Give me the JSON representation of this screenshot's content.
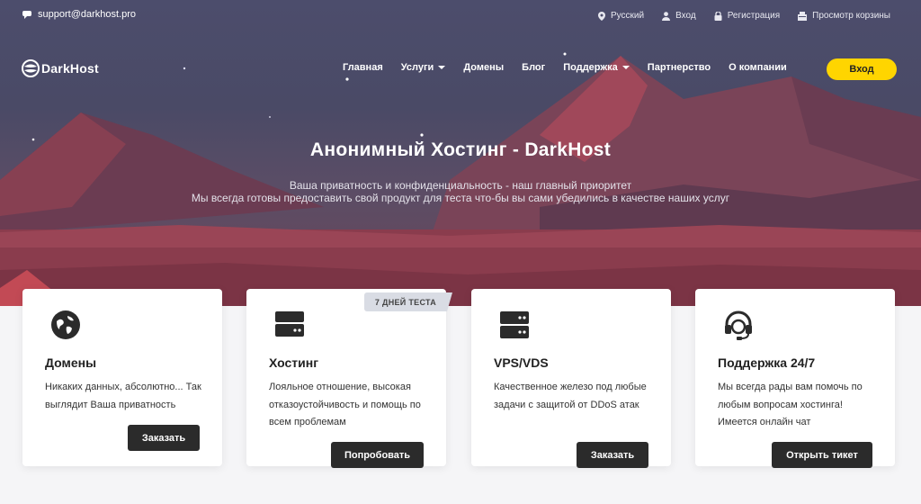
{
  "topbar": {
    "email": "support@darkhost.pro",
    "links": [
      {
        "label": "Русский",
        "icon": "location-pin-icon"
      },
      {
        "label": "Вход",
        "icon": "user-icon"
      },
      {
        "label": "Регистрация",
        "icon": "lock-icon"
      },
      {
        "label": "Просмотр корзины",
        "icon": "cart-icon"
      }
    ]
  },
  "nav": {
    "logo": "DarkHost",
    "items": [
      {
        "label": "Главная",
        "dropdown": false
      },
      {
        "label": "Услуги",
        "dropdown": true
      },
      {
        "label": "Домены",
        "dropdown": false
      },
      {
        "label": "Блог",
        "dropdown": false
      },
      {
        "label": "Поддержка",
        "dropdown": true
      },
      {
        "label": "Партнерство",
        "dropdown": false
      },
      {
        "label": "О компании",
        "dropdown": false
      }
    ],
    "login_button": "Вход"
  },
  "hero": {
    "title": "Анонимный Хостинг - DarkHost",
    "subtitle_line1": "Ваша приватность и конфиденциальность - наш главный приоритет",
    "subtitle_line2": "Мы всегда готовы предоставить свой продукт для теста что-бы вы сами убедились в качестве наших услуг"
  },
  "cards": [
    {
      "title": "Домены",
      "description": "Никаких данных, абсолютно... Так выглядит Ваша приватность",
      "button": "Заказать",
      "icon": "globe-icon"
    },
    {
      "title": "Хостинг",
      "description": "Лояльное отношение, высокая отказоустойчивость и помощь по всем проблемам",
      "button": "Попробовать",
      "icon": "server-icon",
      "ribbon": "7 ДНЕЙ ТЕСТА"
    },
    {
      "title": "VPS/VDS",
      "description": "Качественное железо под любые задачи с защитой от DDoS атак",
      "button": "Заказать",
      "icon": "server-stack-icon"
    },
    {
      "title": "Поддержка 24/7",
      "description": "Мы всегда рады вам помочь по любым вопросам хостинга! Имеется онлайн чат",
      "button": "Открыть тикет",
      "icon": "headset-icon"
    }
  ],
  "colors": {
    "accent": "#ffd500",
    "button_dark": "#2b2b2b",
    "hero_top": "#4c4d6c",
    "mountain": "#8a3c4d"
  }
}
